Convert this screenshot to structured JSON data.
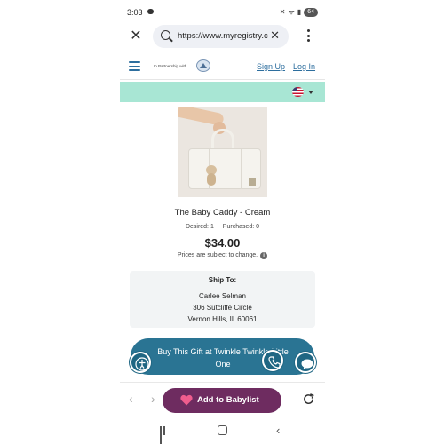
{
  "status_bar": {
    "time": "3:03",
    "signal_text": "ᯤ",
    "battery": "64"
  },
  "browser": {
    "url": "https://www.myregistry.c",
    "close_icon": "close-icon",
    "clear_icon": "clear-icon",
    "menu_icon": "more-vert-icon"
  },
  "site_header": {
    "partner_text": "In Partnership with",
    "signup": "Sign Up",
    "login": "Log In"
  },
  "product": {
    "title": "The Baby Caddy - Cream",
    "desired": "Desired: 1",
    "purchased": "Purchased: 0",
    "price": "$34.00",
    "price_note": "Prices are subject to change.",
    "info_glyph": "i"
  },
  "ship_to": {
    "heading": "Ship To:",
    "name": "Carlee Selman",
    "street": "306 Sutcliffe Circle",
    "city": "Vernon Hills, IL 60061"
  },
  "buy_button": {
    "label": "Buy This Gift at Twinkle Twinkle Little One"
  },
  "bottom_bar": {
    "add_label": "Add to Babylist",
    "back": "‹",
    "forward": "›"
  },
  "colors": {
    "accent": "#2a7493",
    "mint": "#a8e6d4",
    "babylist": "#6e2c60",
    "link": "#2d6e9e"
  }
}
